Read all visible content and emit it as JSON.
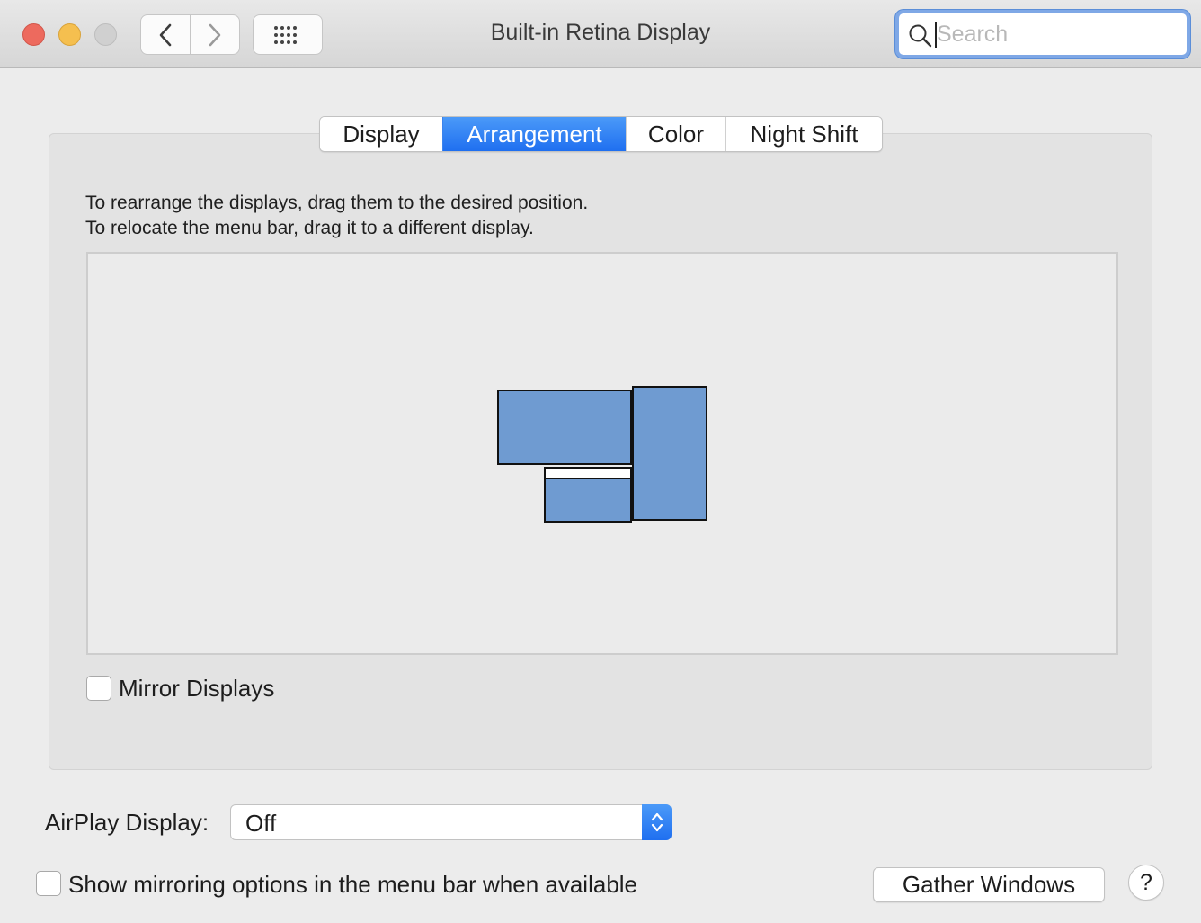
{
  "window": {
    "title": "Built-in Retina Display"
  },
  "toolbar": {
    "back_icon": "chevron-left-icon",
    "forward_icon": "chevron-right-icon",
    "grid_icon": "grid-icon"
  },
  "search": {
    "placeholder": "Search",
    "value": ""
  },
  "tabs": [
    {
      "label": "Display",
      "active": false
    },
    {
      "label": "Arrangement",
      "active": true
    },
    {
      "label": "Color",
      "active": false
    },
    {
      "label": "Night Shift",
      "active": false
    }
  ],
  "arrangement": {
    "instruction_1": "To rearrange the displays, drag them to the desired position.",
    "instruction_2": "To relocate the menu bar, drag it to a different display.",
    "display_color": "#6f9bd1"
  },
  "mirror": {
    "label": "Mirror Displays",
    "checked": false
  },
  "airplay": {
    "label": "AirPlay Display:",
    "value": "Off"
  },
  "show_mirroring": {
    "label": "Show mirroring options in the menu bar when available",
    "checked": false
  },
  "buttons": {
    "gather": "Gather Windows",
    "help": "?"
  },
  "colors": {
    "accent": "#1f6ff0",
    "close": "#ed6a5e",
    "minimize": "#f5bf4f"
  }
}
